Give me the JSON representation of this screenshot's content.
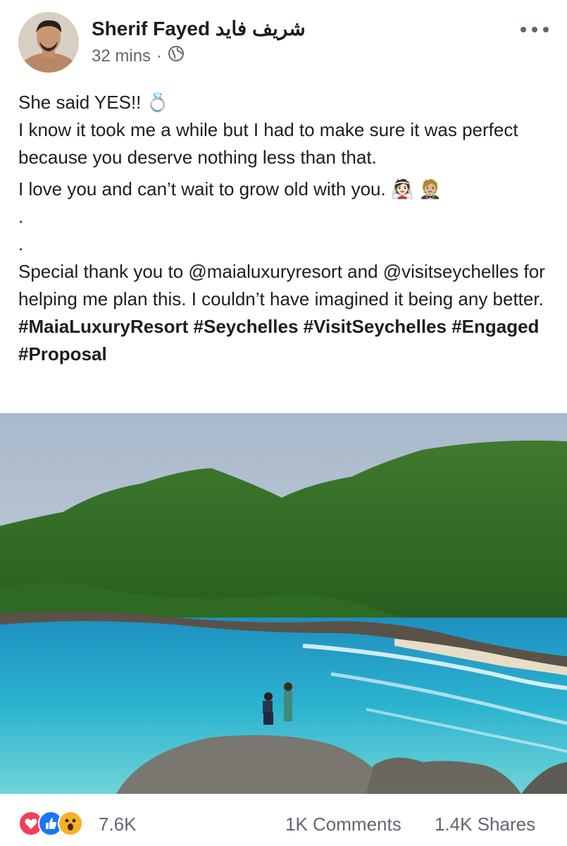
{
  "post": {
    "author": "Sherif Fayed شريف فايد",
    "time": "32 mins",
    "separator": "·",
    "privacy_icon": "globe-icon",
    "lines": [
      "She said YES!! 💍",
      "I know it took me a while but I had to make sure it was perfect because you deserve nothing less than that.",
      "I love you and can’t wait to grow old with you. 👰🏻 🤵🏼",
      ".",
      ".",
      "Special thank you to @maialuxuryresort and @visitseychelles for helping me plan this. I couldn’t have imagined it being any better."
    ],
    "hashtags": "#MaiaLuxuryResort #Seychelles #VisitSeychelles #Engaged #Proposal"
  },
  "footer": {
    "reaction_icons": [
      "love-icon",
      "like-icon",
      "wow-icon"
    ],
    "reaction_count": "7.6K",
    "comments": "1K Comments",
    "shares": "1.4K Shares"
  },
  "colors": {
    "text": "#1c1e21",
    "meta": "#606770",
    "love": "#f33e58",
    "like": "#1877f2",
    "wow": "#f7b125"
  }
}
